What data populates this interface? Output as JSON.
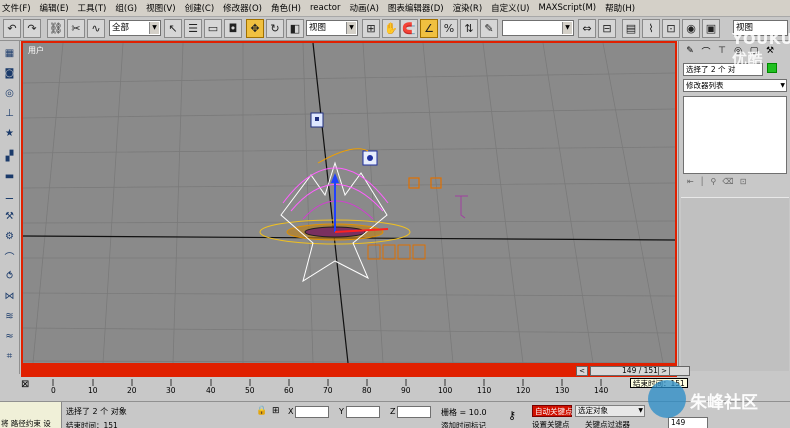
{
  "menu": [
    "文件(F)",
    "编辑(E)",
    "工具(T)",
    "组(G)",
    "视图(V)",
    "创建(C)",
    "修改器(O)",
    "角色(H)",
    "reactor",
    "动画(A)",
    "图表编辑器(D)",
    "渲染(R)",
    "自定义(U)",
    "MAXScript(M)",
    "帮助(H)"
  ],
  "toolbar": {
    "selection_filter": "全部",
    "ref_coord": "视图",
    "named_selection": "",
    "right_view_field": "视图"
  },
  "viewport": {
    "label": "用户"
  },
  "time_slider": {
    "position": "149 / 151"
  },
  "trackbar": {
    "ticks": [
      "0",
      "10",
      "20",
      "30",
      "40",
      "50",
      "60",
      "70",
      "80",
      "90",
      "100",
      "110",
      "120",
      "130",
      "140"
    ]
  },
  "command_panel": {
    "name_field": "选择了 2 个 对",
    "modifier_list": "修改器列表"
  },
  "status": {
    "left_text": "将 路径约束 设 ",
    "selected": "选择了 2 个 对象",
    "x_label": "X",
    "y_label": "Y",
    "z_label": "Z",
    "grid": "栅格 = 10.0",
    "auto_key": "自动关键点",
    "set_key": "设置关键点",
    "key_filter": "选定对象",
    "key_filters_btn": "关键点过滤器",
    "add_tag": "添加时间标记",
    "frame": "149",
    "bottom_left": "结束时间：151",
    "tooltip": "结束时间：151"
  },
  "watermark": {
    "top": "YOUKU 优酷",
    "bottom": "朱峰社区"
  },
  "colors": {
    "viewport_border": "#e02000",
    "viewport_bg": "#8a8a8a",
    "auto_key": "#d01000"
  }
}
